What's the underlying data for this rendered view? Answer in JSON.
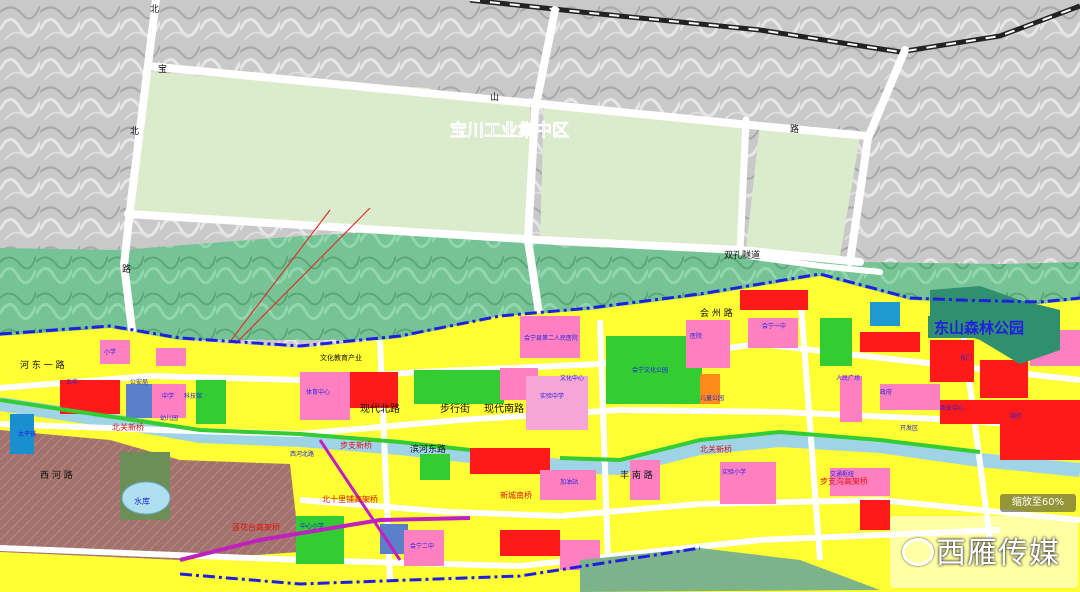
{
  "map": {
    "industrial_zone": "宝川工业集中区",
    "forest_park": "东山森林公园",
    "roads": {
      "baochuan_north_1": "宝",
      "baochuan_north_2": "川",
      "baochuan_west_1": "路",
      "baochuan_west_2": "北",
      "baochuan_west_3": "路",
      "top_road_char": "北",
      "shan_road_1": "山",
      "shan_road_2": "路",
      "shuangkong": "双孔隧道",
      "west_road_1": "路",
      "hedong": "河 东 一 路",
      "bei": "北",
      "xiandai_bei": "现代北路",
      "xiandai_nan": "现代南路",
      "bu_xing": "步行街",
      "wenhua": "文化教育产业",
      "binhe": "滨河东路",
      "fengnan": "丰 南 路",
      "xihe": "西 河 路",
      "huizhou": "会 州 路"
    },
    "bridges": {
      "b1": "北关新桥",
      "b2": "北关新桥",
      "b3": "步支新桥",
      "b4": "莲花台高架桥",
      "b5": "北十里铺高架桥",
      "b6": "新城南桥",
      "b7": "步支沟高架桥"
    },
    "pois": {
      "xiaoxue1": "小学",
      "zhongxue": "中学",
      "wuzhong": "五中",
      "gongan": "公安局",
      "kexue": "科技馆",
      "youeryuan": "幼儿园",
      "shuiku": "水库",
      "tiyu": "体育中心",
      "huining_yi": "会宁一中",
      "renmin_yy": "会宁县第二人民医院",
      "gongyuan": "会宁文化公园",
      "shiyan": "实验中学",
      "yiyuan": "医院",
      "renmin_gc": "人民广场",
      "zhengfu": "政府",
      "wenhua_zx": "文化中心",
      "ertong_gy": "儿童公园",
      "shiyan_xx": "实验小学",
      "taipingpu": "太平铺",
      "xi_he": "西河北路",
      "shangye": "商业中心",
      "jiaotong": "交通枢纽",
      "dongmen": "东门",
      "kaifa": "开发区",
      "huining_er": "会宁二中",
      "zhongxin_xx": "中心小学",
      "jiayou": "加油站",
      "yinhang": "银行"
    },
    "watermark": "西雁传媒",
    "zoom_label": "缩放至60%",
    "colors": {
      "residential": "#ffff00",
      "commercial": "#ff1a1a",
      "public": "#ff80c0",
      "greenspace": "#33cc33",
      "forest": "#6fbf8e",
      "industrial_field": "#d9ecd0",
      "boundary": "#1f1fe0",
      "river": "#b0d8e6",
      "rail": "#222222",
      "terrain": "#c8c8c8",
      "village": "#a0706a",
      "school": "#f2a0e0"
    }
  }
}
